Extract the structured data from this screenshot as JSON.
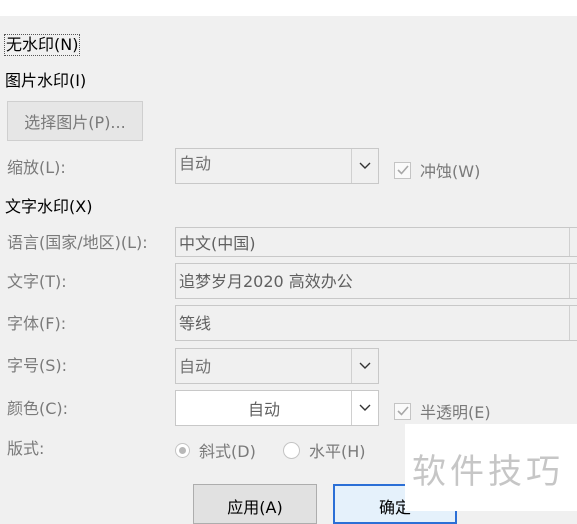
{
  "options": {
    "no_watermark": "无水印(N)",
    "picture_watermark": "图片水印(I)",
    "text_watermark": "文字水印(X)"
  },
  "picture": {
    "select_button": "选择图片(P)...",
    "scale_label": "缩放(L):",
    "scale_value": "自动",
    "washout_label": "冲蚀(W)"
  },
  "text": {
    "language_label": "语言(国家/地区)(L):",
    "language_value": "中文(中国)",
    "text_label": "文字(T):",
    "text_value": "追梦岁月2020  高效办公",
    "font_label": "字体(F):",
    "font_value": "等线",
    "size_label": "字号(S):",
    "size_value": "自动",
    "color_label": "颜色(C):",
    "color_value": "自动",
    "semitransparent_label": "半透明(E)",
    "layout_label": "版式:",
    "diagonal_label": "斜式(D)",
    "horizontal_label": "水平(H)"
  },
  "buttons": {
    "apply": "应用(A)",
    "ok": "确定"
  },
  "watermark_text": "软件技巧",
  "colors": {
    "background": "#f0f0f0",
    "border": "#c8c8c8",
    "disabled_text": "#7a7a7a",
    "focus_blue": "#2b6fd6"
  }
}
